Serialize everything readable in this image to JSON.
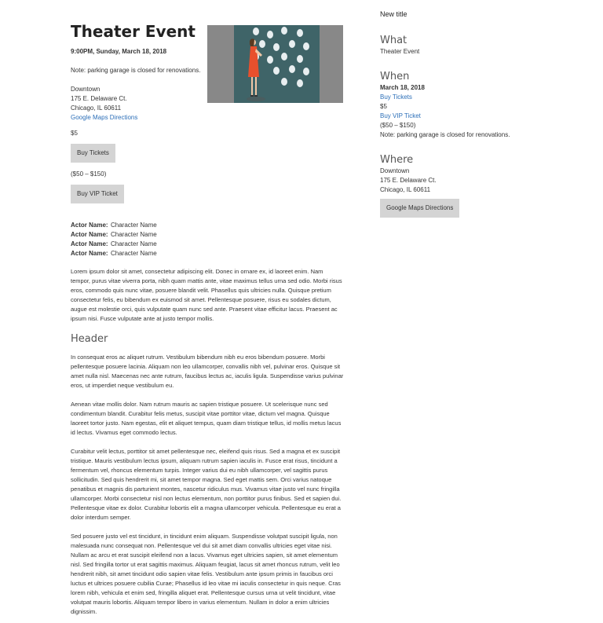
{
  "event": {
    "title": "Theater Event",
    "datetime": "9:00PM, Sunday, March 18, 2018",
    "note": "Note: parking garage is closed for renovations.",
    "venue": "Downtown",
    "street": "175 E. Delaware Ct.",
    "city": "Chicago, IL 60611",
    "maps_link": "Google Maps Directions",
    "price": "$5",
    "buy_tickets": "Buy Tickets",
    "vip_range": "($50 – $150)",
    "buy_vip": "Buy VIP Ticket"
  },
  "actors": [
    {
      "label": "Actor Name:",
      "value": "Character Name"
    },
    {
      "label": "Actor Name:",
      "value": "Character Name"
    },
    {
      "label": "Actor Name:",
      "value": "Character Name"
    },
    {
      "label": "Actor Name:",
      "value": "Character Name"
    }
  ],
  "body": {
    "intro": "Lorem ipsum dolor sit amet, consectetur adipiscing elit. Donec in ornare ex, id laoreet enim. Nam tempor, purus vitae viverra porta, nibh quam mattis ante, vitae maximus tellus urna sed odio. Morbi risus eros, commodo quis nunc vitae, posuere blandit velit. Phasellus quis ultricies nulla. Quisque pretium consectetur felis, eu bibendum ex euismod sit amet. Pellentesque posuere, risus eu sodales dictum, augue est molestie orci, quis vulputate quam nunc sed ante. Praesent vitae efficitur lacus. Praesent ac ipsum nisi. Fusce vulputate ante at justo tempor mollis.",
    "header": "Header",
    "paragraphs": [
      "In consequat eros ac aliquet rutrum. Vestibulum bibendum nibh eu eros bibendum posuere. Morbi pellentesque posuere lacinia. Aliquam non leo ullamcorper, convallis nibh vel, pulvinar eros. Quisque sit amet nulla nisl. Maecenas nec ante rutrum, faucibus lectus ac, iaculis ligula. Suspendisse varius pulvinar eros, ut imperdiet neque vestibulum eu.",
      "Aenean vitae mollis dolor. Nam rutrum mauris ac sapien tristique posuere. Ut scelerisque nunc sed condimentum blandit. Curabitur felis metus, suscipit vitae porttitor vitae, dictum vel magna. Quisque laoreet tortor justo. Nam egestas, elit et aliquet tempus, quam diam tristique tellus, id mollis metus lacus id lectus. Vivamus eget commodo lectus.",
      "Curabitur velit lectus, porttitor sit amet pellentesque nec, eleifend quis risus. Sed a magna et ex suscipit tristique. Mauris vestibulum lectus ipsum, aliquam rutrum sapien iaculis in. Fusce erat risus, tincidunt a fermentum vel, rhoncus elementum turpis. Integer varius dui eu nibh ullamcorper, vel sagittis purus sollicitudin. Sed quis hendrerit mi, sit amet tempor magna. Sed eget mattis sem. Orci varius natoque penatibus et magnis dis parturient montes, nascetur ridiculus mus. Vivamus vitae justo vel nunc fringilla ullamcorper. Morbi consectetur nisl non lectus elementum, non porttitor purus finibus. Sed et sapien dui. Pellentesque vitae ex dolor. Curabitur lobortis elit a magna ullamcorper vehicula. Pellentesque eu erat a dolor interdum semper.",
      "Sed posuere justo vel est tincidunt, in tincidunt enim aliquam. Suspendisse volutpat suscipit ligula, non malesuada nunc consequat non. Pellentesque vel dui sit amet diam convallis ultricies eget vitae nisi. Nullam ac arcu et erat suscipit eleifend non a lacus. Vivamus eget ultricies sapien, sit amet elementum nisl. Sed fringilla tortor ut erat sagittis maximus. Aliquam feugiat, lacus sit amet rhoncus rutrum, velit leo hendrerit nibh, sit amet tincidunt odio sapien vitae felis. Vestibulum ante ipsum primis in faucibus orci luctus et ultrices posuere cubilia Curae; Phasellus id leo vitae mi iaculis consectetur in quis neque. Cras lorem nibh, vehicula et enim sed, fringilla aliquet erat. Pellentesque cursus urna ut velit tincidunt, vitae volutpat mauris lobortis. Aliquam tempor libero in varius elementum. Nullam in dolor a enim ultricies dignissim."
    ]
  },
  "sidebar": {
    "top_title": "New title",
    "what_heading": "What",
    "what_value": "Theater Event",
    "when_heading": "When",
    "when_date": "March 18, 2018",
    "buy_tickets": "Buy Tickets",
    "price": "$5",
    "buy_vip": "Buy VIP Ticket",
    "vip_range": "($50 – $150)",
    "note": "Note: parking garage is closed for renovations.",
    "where_heading": "Where",
    "venue": "Downtown",
    "street": "175 E. Delaware Ct.",
    "city": "Chicago, IL 60611",
    "maps_button": "Google Maps Directions"
  },
  "colors": {
    "link": "#2c6fb8",
    "button_bg": "#d4d4d4",
    "image_bg": "#888888",
    "wall": "#3f6468",
    "dress": "#e8502d"
  },
  "icons": {
    "hero": "woman-at-mask-wall-illustration"
  }
}
